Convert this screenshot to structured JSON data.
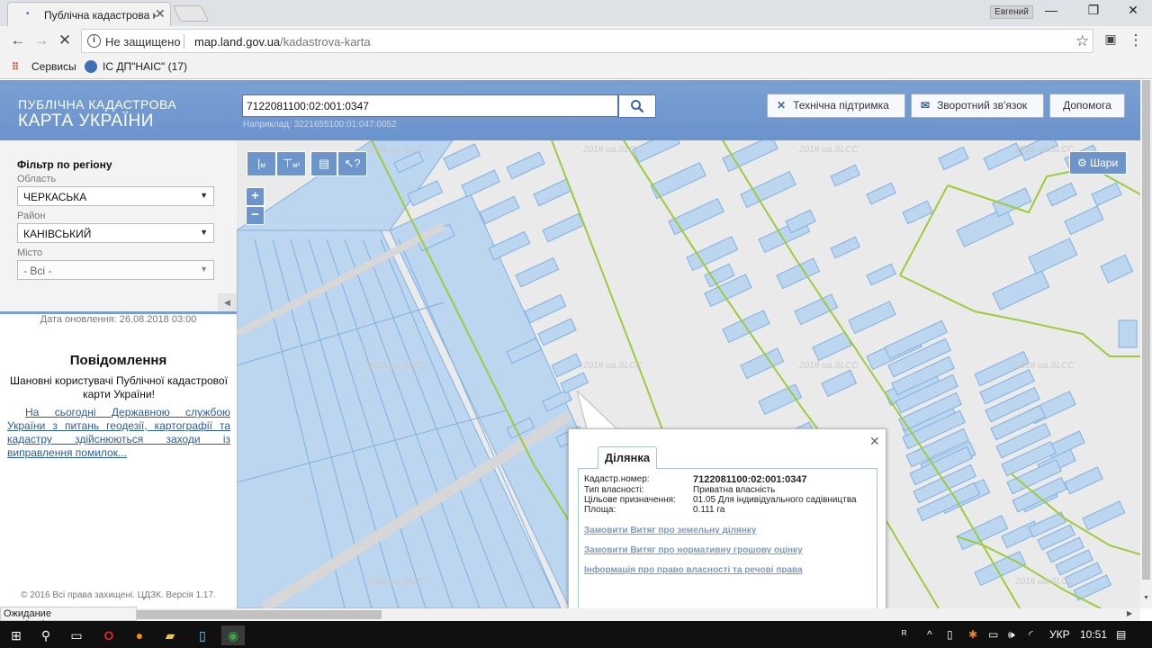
{
  "browser": {
    "tab_title": "Публічна кадастрова ка",
    "user": "Евгений",
    "security_label": "Не защищено",
    "url_host": "map.land.gov.ua",
    "url_path": "/kadastrova-karta",
    "bookmarks": [
      {
        "label": "Сервисы"
      },
      {
        "label": "ІС ДП\"НАІС\" (17)"
      }
    ],
    "status": "Ожидание map.land.gov.ua..."
  },
  "site": {
    "logo_line1": "ПУБЛІЧНА КАДАСТРОВА",
    "logo_line2": "КАРТА УКРАЇНИ",
    "search_value": "7122081100:02:001:0347",
    "search_example": "Наприклад: 3221655100:01:047:0052",
    "header_buttons": [
      {
        "label": "Технічна підтримка"
      },
      {
        "label": "Зворотний зв'язок"
      },
      {
        "label": "Допомога"
      }
    ]
  },
  "filter": {
    "title": "Фільтр по регіону",
    "oblast_label": "Область",
    "oblast_value": "ЧЕРКАСЬКА",
    "rayon_label": "Район",
    "rayon_value": "КАНІВСЬКИЙ",
    "misto_label": "Місто",
    "misto_value": "- Всі -"
  },
  "sidebar": {
    "updated": "Дата оновлення: 26.08.2018 03:00",
    "notice_title": "Повідомлення",
    "notice_text": "Шановні користувачі Публічної кадастрової карти України!",
    "notice_link": "На сьогодні Державною службою України з питань геодезії, картографії та кадастру здійснюються заходи із виправлення помилок...",
    "copyright": "© 2016 Всі права захищені. ЦДЗК. Версія 1.17."
  },
  "map": {
    "layers_label": "Шари",
    "watermark": "2018 ua.SLCC",
    "zoom_in": "+",
    "zoom_out": "−"
  },
  "popup": {
    "tab_label": "Ділянка",
    "rows": [
      {
        "key": "Кадастр.номер:",
        "value": "7122081100:02:001:0347"
      },
      {
        "key": "Тип власності:",
        "value": "Приватна власність"
      },
      {
        "key": "Цільове призначення:",
        "value": "01.05 Для індивідуального садівництва"
      },
      {
        "key": "Площа:",
        "value": "0.111 га"
      }
    ],
    "links": [
      {
        "label": "Замовити Витяг про земельну ділянку"
      },
      {
        "label": "Замовити Витяг про нормативну грошову оцінку"
      },
      {
        "label": "Інформація про право власності та речові права"
      }
    ]
  },
  "taskbar": {
    "lang": "УКР",
    "time": "10:51"
  },
  "colors": {
    "header_blue": "#6b93cc",
    "parcel_fill": "#bcd6f0",
    "parcel_stroke": "#7fb0e0",
    "boundary_green": "#9ccc3c"
  }
}
